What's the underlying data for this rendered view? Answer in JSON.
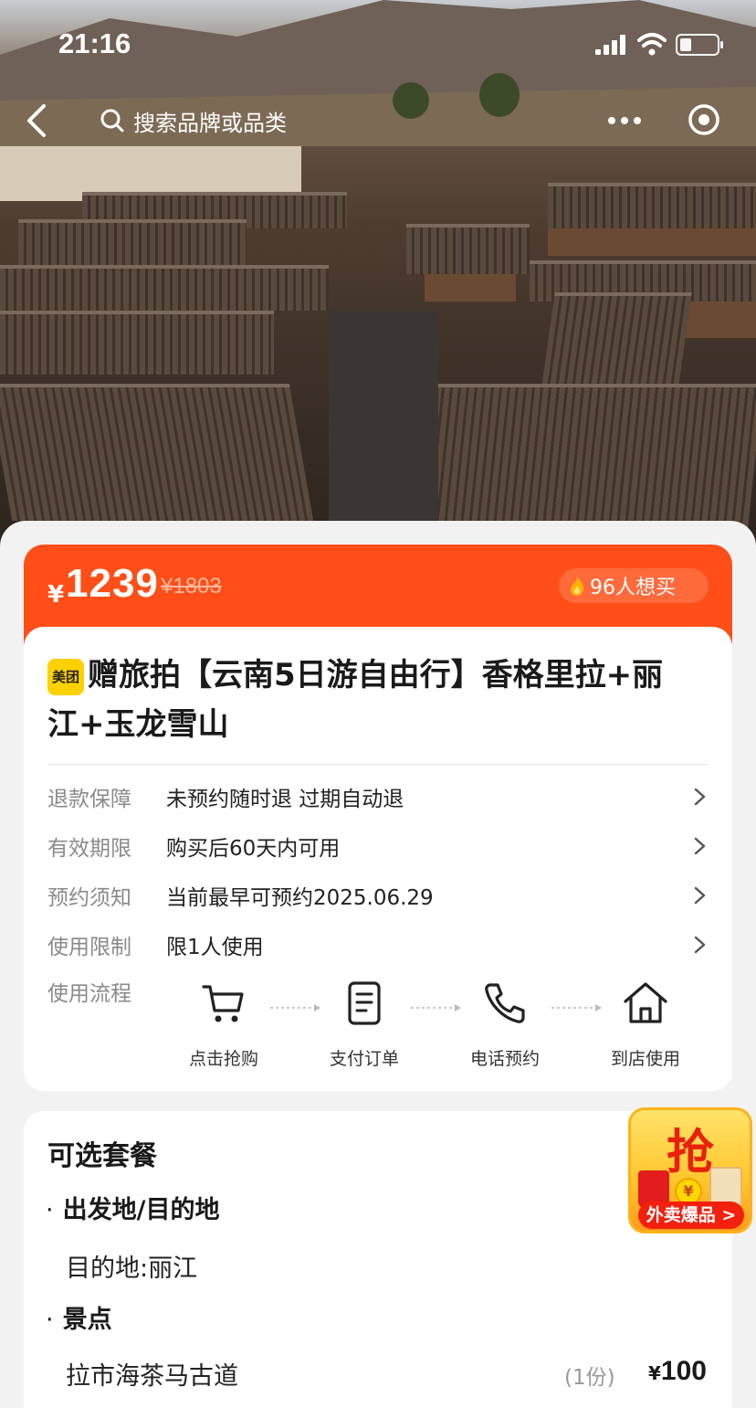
{
  "status_bar": {
    "time": "21:16"
  },
  "nav": {
    "search_placeholder": "搜索品牌或品类"
  },
  "price": {
    "currency": "¥",
    "current": "1239",
    "original": "¥1803",
    "want_count": "96人想买"
  },
  "product": {
    "brand_badge": "美团",
    "title": "赠旅拍【云南5日游自由行】香格里拉+丽江+玉龙雪山"
  },
  "info_rows": [
    {
      "key": "退款保障",
      "value": "未预约随时退 过期自动退"
    },
    {
      "key": "有效期限",
      "value": "购买后60天内可用"
    },
    {
      "key": "预约须知",
      "value": "当前最早可预约2025.06.29"
    },
    {
      "key": "使用限制",
      "value": "限1人使用"
    }
  ],
  "flow": {
    "label": "使用流程",
    "steps": [
      {
        "icon": "cart-icon",
        "label": "点击抢购"
      },
      {
        "icon": "receipt-icon",
        "label": "支付订单"
      },
      {
        "icon": "phone-icon",
        "label": "电话预约"
      },
      {
        "icon": "home-icon",
        "label": "到店使用"
      }
    ]
  },
  "packages": {
    "title": "可选套餐",
    "section1_label": "出发地/目的地",
    "destination": "目的地:丽江",
    "section2_label": "景点",
    "item_name": "拉市海茶马古道",
    "item_qty": "(1份)",
    "item_currency": "¥",
    "item_price": "100"
  },
  "promo": {
    "headline": "抢",
    "coin": "¥",
    "tag": "外卖爆品 >"
  },
  "colors": {
    "accent": "#ff4e17",
    "brand_yellow": "#ffd100",
    "promo_red": "#f2200d"
  }
}
